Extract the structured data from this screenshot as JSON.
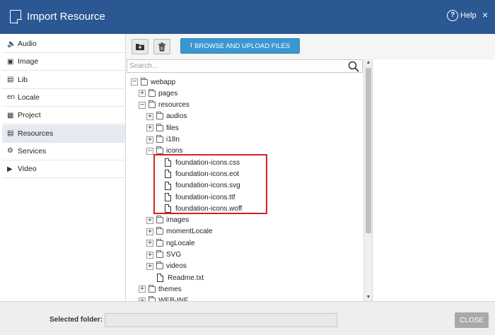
{
  "window": {
    "title": "Import Resource",
    "help_label": "Help",
    "close_glyph": "×"
  },
  "sidebar": {
    "items": [
      {
        "label": "Audio",
        "icon": "speaker-icon",
        "glyph": "🔈"
      },
      {
        "label": "Image",
        "icon": "image-icon",
        "glyph": "▣"
      },
      {
        "label": "Lib",
        "icon": "lib-icon",
        "glyph": "▤"
      },
      {
        "label": "Locale",
        "icon": "locale-icon",
        "glyph": "en"
      },
      {
        "label": "Project",
        "icon": "project-icon",
        "glyph": "▦"
      },
      {
        "label": "Resources",
        "icon": "resources-icon",
        "glyph": "▤"
      },
      {
        "label": "Services",
        "icon": "services-icon",
        "glyph": "⚙"
      },
      {
        "label": "Video",
        "icon": "video-icon",
        "glyph": "▶"
      }
    ],
    "active_index": 5
  },
  "toolbar": {
    "upload_label": "BROWSE AND UPLOAD FILES",
    "upload_glyph": "⭱"
  },
  "search": {
    "placeholder": "Search..."
  },
  "tree": {
    "nodes": [
      {
        "label": "webapp",
        "level": 0,
        "type": "folder",
        "expander": "−"
      },
      {
        "label": "pages",
        "level": 1,
        "type": "folder",
        "expander": "+"
      },
      {
        "label": "resources",
        "level": 1,
        "type": "folder",
        "expander": "−"
      },
      {
        "label": "audios",
        "level": 2,
        "type": "folder",
        "expander": "+"
      },
      {
        "label": "files",
        "level": 2,
        "type": "folder",
        "expander": "+"
      },
      {
        "label": "i18n",
        "level": 2,
        "type": "folder",
        "expander": "+"
      },
      {
        "label": "icons",
        "level": 2,
        "type": "folder",
        "expander": "−"
      },
      {
        "label": "foundation-icons.css",
        "level": 3,
        "type": "file",
        "expander": ""
      },
      {
        "label": "foundation-icons.eot",
        "level": 3,
        "type": "file",
        "expander": ""
      },
      {
        "label": "foundation-icons.svg",
        "level": 3,
        "type": "file",
        "expander": ""
      },
      {
        "label": "foundation-icons.ttf",
        "level": 3,
        "type": "file",
        "expander": ""
      },
      {
        "label": "foundation-icons.woff",
        "level": 3,
        "type": "file",
        "expander": ""
      },
      {
        "label": "images",
        "level": 2,
        "type": "folder",
        "expander": "+"
      },
      {
        "label": "momentLocale",
        "level": 2,
        "type": "folder",
        "expander": "+"
      },
      {
        "label": "ngLocale",
        "level": 2,
        "type": "folder",
        "expander": "+"
      },
      {
        "label": "SVG",
        "level": 2,
        "type": "folder",
        "expander": "+"
      },
      {
        "label": "videos",
        "level": 2,
        "type": "folder",
        "expander": "+"
      },
      {
        "label": "Readme.txt",
        "level": 2,
        "type": "file",
        "expander": ""
      },
      {
        "label": "themes",
        "level": 1,
        "type": "folder",
        "expander": "+"
      },
      {
        "label": "WEB-INF",
        "level": 1,
        "type": "folder",
        "expander": "+"
      }
    ]
  },
  "footer": {
    "selected_folder_label": "Selected folder:",
    "selected_folder_value": "",
    "close_label": "CLOSE"
  },
  "colors": {
    "title_bar": "#2b5793",
    "upload_button": "#3a97d1",
    "highlight_border": "#d42222",
    "sidebar_active": "#e5e9f2"
  }
}
